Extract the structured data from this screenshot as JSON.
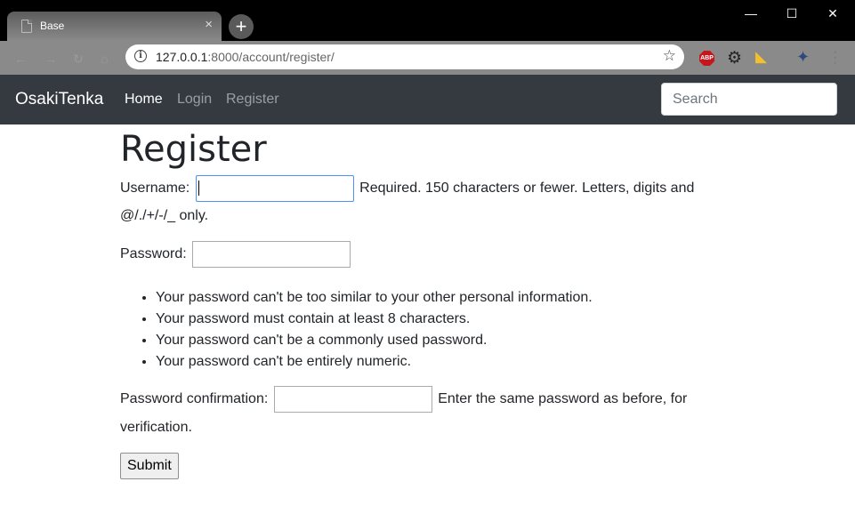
{
  "browser": {
    "tab_title": "Base",
    "tab_close": "×",
    "new_tab": "+",
    "window_controls": {
      "minimize": "—",
      "maximize": "☐",
      "close": "✕"
    },
    "url_host": "127.0.0.1",
    "url_rest": ":8000/account/register/",
    "extensions": {
      "adblock_label": "ABP"
    }
  },
  "navbar": {
    "brand": "OsakiTenka",
    "links": [
      {
        "label": "Home",
        "active": true
      },
      {
        "label": "Login",
        "active": false
      },
      {
        "label": "Register",
        "active": false
      }
    ],
    "search_placeholder": "Search"
  },
  "page": {
    "title": "Register",
    "username_label": "Username:",
    "username_help_1": "Required. 150 characters or fewer. Letters, digits and",
    "username_help_2": "@/./+/-/_ only.",
    "password_label": "Password:",
    "password_rules": [
      "Your password can't be too similar to your other personal information.",
      "Your password must contain at least 8 characters.",
      "Your password can't be a commonly used password.",
      "Your password can't be entirely numeric."
    ],
    "confirm_label": "Password confirmation:",
    "confirm_help_1": "Enter the same password as before, for",
    "confirm_help_2": "verification.",
    "submit_label": "Submit"
  },
  "colors": {
    "navbar_bg": "#343a40",
    "focus_border": "#4d90fe",
    "text": "#212529"
  }
}
